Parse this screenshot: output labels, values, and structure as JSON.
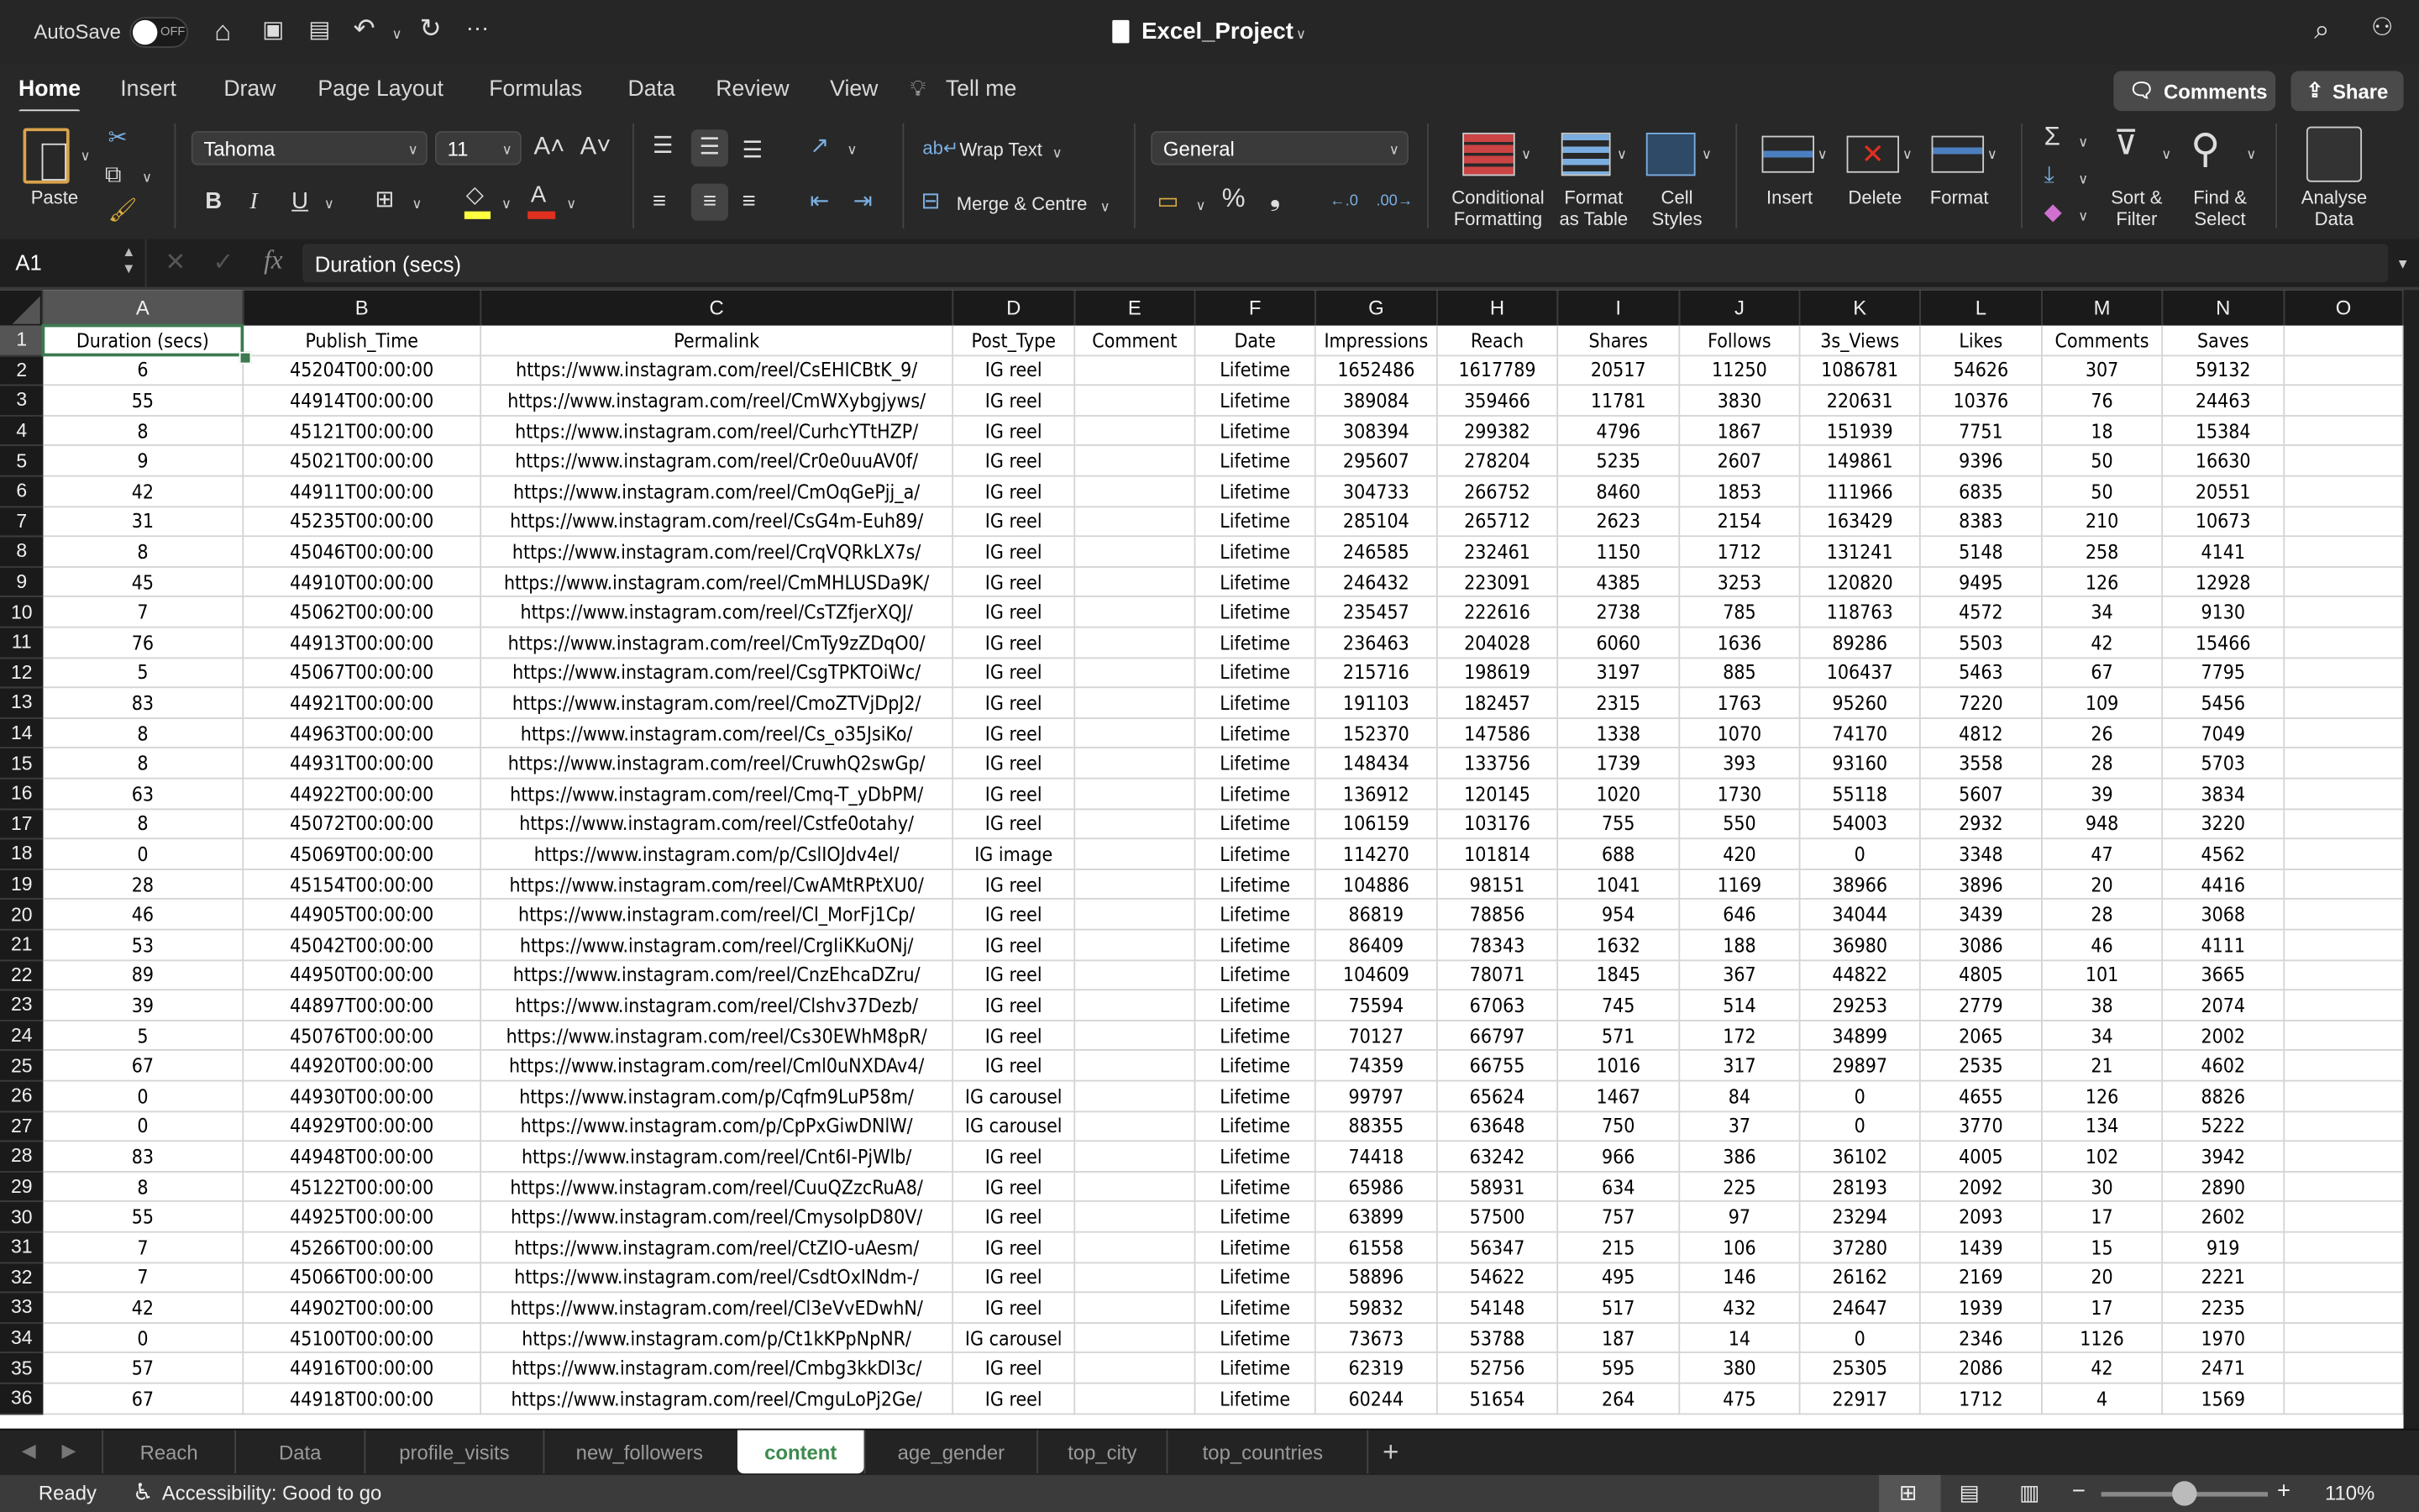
{
  "titlebar": {
    "autosave_label": "AutoSave",
    "autosave_state": "OFF",
    "title": "Excel_Project"
  },
  "menu_tabs": [
    "Home",
    "Insert",
    "Draw",
    "Page Layout",
    "Formulas",
    "Data",
    "Review",
    "View"
  ],
  "tell_me": "Tell me",
  "comments_label": "Comments",
  "share_label": "Share",
  "ribbon": {
    "paste": "Paste",
    "font_name": "Tahoma",
    "font_size": "11",
    "bold": "B",
    "italic": "I",
    "underline": "U",
    "wrap_text": "Wrap Text",
    "merge_centre": "Merge & Centre",
    "number_format": "General",
    "conditional_formatting": [
      "Conditional",
      "Formatting"
    ],
    "format_as_table": [
      "Format",
      "as Table"
    ],
    "cell_styles": [
      "Cell",
      "Styles"
    ],
    "insert": "Insert",
    "delete": "Delete",
    "format": "Format",
    "sort_filter": [
      "Sort &",
      "Filter"
    ],
    "find_select": [
      "Find &",
      "Select"
    ],
    "analyse_data": [
      "Analyse",
      "Data"
    ],
    "fill_color": "#ffff00",
    "font_color": "#e03020"
  },
  "formula_bar": {
    "name_box": "A1",
    "fx": "fx",
    "content": "Duration (secs)"
  },
  "columns": [
    "A",
    "B",
    "C",
    "D",
    "E",
    "F",
    "G",
    "H",
    "I",
    "J",
    "K",
    "L",
    "M",
    "N",
    "O"
  ],
  "header_row": [
    "Duration (secs)",
    "Publish_Time",
    "Permalink",
    "Post_Type",
    "Comment",
    "Date",
    "Impressions",
    "Reach",
    "Shares",
    "Follows",
    "3s_Views",
    "Likes",
    "Comments",
    "Saves",
    ""
  ],
  "rows": [
    [
      "6",
      "45204T00:00:00",
      "https://www.instagram.com/reel/CsEHICBtK_9/",
      "IG reel",
      "",
      "Lifetime",
      "1652486",
      "1617789",
      "20517",
      "11250",
      "1086781",
      "54626",
      "307",
      "59132",
      ""
    ],
    [
      "55",
      "44914T00:00:00",
      "https://www.instagram.com/reel/CmWXybgjyws/",
      "IG reel",
      "",
      "Lifetime",
      "389084",
      "359466",
      "11781",
      "3830",
      "220631",
      "10376",
      "76",
      "24463",
      ""
    ],
    [
      "8",
      "45121T00:00:00",
      "https://www.instagram.com/reel/CurhcYTtHZP/",
      "IG reel",
      "",
      "Lifetime",
      "308394",
      "299382",
      "4796",
      "1867",
      "151939",
      "7751",
      "18",
      "15384",
      ""
    ],
    [
      "9",
      "45021T00:00:00",
      "https://www.instagram.com/reel/Cr0e0uuAV0f/",
      "IG reel",
      "",
      "Lifetime",
      "295607",
      "278204",
      "5235",
      "2607",
      "149861",
      "9396",
      "50",
      "16630",
      ""
    ],
    [
      "42",
      "44911T00:00:00",
      "https://www.instagram.com/reel/CmOqGePjj_a/",
      "IG reel",
      "",
      "Lifetime",
      "304733",
      "266752",
      "8460",
      "1853",
      "111966",
      "6835",
      "50",
      "20551",
      ""
    ],
    [
      "31",
      "45235T00:00:00",
      "https://www.instagram.com/reel/CsG4m-Euh89/",
      "IG reel",
      "",
      "Lifetime",
      "285104",
      "265712",
      "2623",
      "2154",
      "163429",
      "8383",
      "210",
      "10673",
      ""
    ],
    [
      "8",
      "45046T00:00:00",
      "https://www.instagram.com/reel/CrqVQRkLX7s/",
      "IG reel",
      "",
      "Lifetime",
      "246585",
      "232461",
      "1150",
      "1712",
      "131241",
      "5148",
      "258",
      "4141",
      ""
    ],
    [
      "45",
      "44910T00:00:00",
      "https://www.instagram.com/reel/CmMHLUSDa9K/",
      "IG reel",
      "",
      "Lifetime",
      "246432",
      "223091",
      "4385",
      "3253",
      "120820",
      "9495",
      "126",
      "12928",
      ""
    ],
    [
      "7",
      "45062T00:00:00",
      "https://www.instagram.com/reel/CsTZfjerXQJ/",
      "IG reel",
      "",
      "Lifetime",
      "235457",
      "222616",
      "2738",
      "785",
      "118763",
      "4572",
      "34",
      "9130",
      ""
    ],
    [
      "76",
      "44913T00:00:00",
      "https://www.instagram.com/reel/CmTy9zZDqO0/",
      "IG reel",
      "",
      "Lifetime",
      "236463",
      "204028",
      "6060",
      "1636",
      "89286",
      "5503",
      "42",
      "15466",
      ""
    ],
    [
      "5",
      "45067T00:00:00",
      "https://www.instagram.com/reel/CsgTPKTOiWc/",
      "IG reel",
      "",
      "Lifetime",
      "215716",
      "198619",
      "3197",
      "885",
      "106437",
      "5463",
      "67",
      "7795",
      ""
    ],
    [
      "83",
      "44921T00:00:00",
      "https://www.instagram.com/reel/CmoZTVjDpJ2/",
      "IG reel",
      "",
      "Lifetime",
      "191103",
      "182457",
      "2315",
      "1763",
      "95260",
      "7220",
      "109",
      "5456",
      ""
    ],
    [
      "8",
      "44963T00:00:00",
      "https://www.instagram.com/reel/Cs_o35JsiKo/",
      "IG reel",
      "",
      "Lifetime",
      "152370",
      "147586",
      "1338",
      "1070",
      "74170",
      "4812",
      "26",
      "7049",
      ""
    ],
    [
      "8",
      "44931T00:00:00",
      "https://www.instagram.com/reel/CruwhQ2swGp/",
      "IG reel",
      "",
      "Lifetime",
      "148434",
      "133756",
      "1739",
      "393",
      "93160",
      "3558",
      "28",
      "5703",
      ""
    ],
    [
      "63",
      "44922T00:00:00",
      "https://www.instagram.com/reel/Cmq-T_yDbPM/",
      "IG reel",
      "",
      "Lifetime",
      "136912",
      "120145",
      "1020",
      "1730",
      "55118",
      "5607",
      "39",
      "3834",
      ""
    ],
    [
      "8",
      "45072T00:00:00",
      "https://www.instagram.com/reel/Cstfe0otahy/",
      "IG reel",
      "",
      "Lifetime",
      "106159",
      "103176",
      "755",
      "550",
      "54003",
      "2932",
      "948",
      "3220",
      ""
    ],
    [
      "0",
      "45069T00:00:00",
      "https://www.instagram.com/p/CslIOJdv4el/",
      "IG image",
      "",
      "Lifetime",
      "114270",
      "101814",
      "688",
      "420",
      "0",
      "3348",
      "47",
      "4562",
      ""
    ],
    [
      "28",
      "45154T00:00:00",
      "https://www.instagram.com/reel/CwAMtRPtXU0/",
      "IG reel",
      "",
      "Lifetime",
      "104886",
      "98151",
      "1041",
      "1169",
      "38966",
      "3896",
      "20",
      "4416",
      ""
    ],
    [
      "46",
      "44905T00:00:00",
      "https://www.instagram.com/reel/Cl_MorFj1Cp/",
      "IG reel",
      "",
      "Lifetime",
      "86819",
      "78856",
      "954",
      "646",
      "34044",
      "3439",
      "28",
      "3068",
      ""
    ],
    [
      "53",
      "45042T00:00:00",
      "https://www.instagram.com/reel/CrgIiKKuONj/",
      "IG reel",
      "",
      "Lifetime",
      "86409",
      "78343",
      "1632",
      "188",
      "36980",
      "3086",
      "46",
      "4111",
      ""
    ],
    [
      "89",
      "44950T00:00:00",
      "https://www.instagram.com/reel/CnzEhcaDZru/",
      "IG reel",
      "",
      "Lifetime",
      "104609",
      "78071",
      "1845",
      "367",
      "44822",
      "4805",
      "101",
      "3665",
      ""
    ],
    [
      "39",
      "44897T00:00:00",
      "https://www.instagram.com/reel/Clshv37Dezb/",
      "IG reel",
      "",
      "Lifetime",
      "75594",
      "67063",
      "745",
      "514",
      "29253",
      "2779",
      "38",
      "2074",
      ""
    ],
    [
      "5",
      "45076T00:00:00",
      "https://www.instagram.com/reel/Cs30EWhM8pR/",
      "IG reel",
      "",
      "Lifetime",
      "70127",
      "66797",
      "571",
      "172",
      "34899",
      "2065",
      "34",
      "2002",
      ""
    ],
    [
      "67",
      "44920T00:00:00",
      "https://www.instagram.com/reel/Cml0uNXDAv4/",
      "IG reel",
      "",
      "Lifetime",
      "74359",
      "66755",
      "1016",
      "317",
      "29897",
      "2535",
      "21",
      "4602",
      ""
    ],
    [
      "0",
      "44930T00:00:00",
      "https://www.instagram.com/p/Cqfm9LuP58m/",
      "IG carousel",
      "",
      "Lifetime",
      "99797",
      "65624",
      "1467",
      "84",
      "0",
      "4655",
      "126",
      "8826",
      ""
    ],
    [
      "0",
      "44929T00:00:00",
      "https://www.instagram.com/p/CpPxGiwDNlW/",
      "IG carousel",
      "",
      "Lifetime",
      "88355",
      "63648",
      "750",
      "37",
      "0",
      "3770",
      "134",
      "5222",
      ""
    ],
    [
      "83",
      "44948T00:00:00",
      "https://www.instagram.com/reel/Cnt6I-PjWlb/",
      "IG reel",
      "",
      "Lifetime",
      "74418",
      "63242",
      "966",
      "386",
      "36102",
      "4005",
      "102",
      "3942",
      ""
    ],
    [
      "8",
      "45122T00:00:00",
      "https://www.instagram.com/reel/CuuQZzcRuA8/",
      "IG reel",
      "",
      "Lifetime",
      "65986",
      "58931",
      "634",
      "225",
      "28193",
      "2092",
      "30",
      "2890",
      ""
    ],
    [
      "55",
      "44925T00:00:00",
      "https://www.instagram.com/reel/CmysoIpD80V/",
      "IG reel",
      "",
      "Lifetime",
      "63899",
      "57500",
      "757",
      "97",
      "23294",
      "2093",
      "17",
      "2602",
      ""
    ],
    [
      "7",
      "45266T00:00:00",
      "https://www.instagram.com/reel/CtZIO-uAesm/",
      "IG reel",
      "",
      "Lifetime",
      "61558",
      "56347",
      "215",
      "106",
      "37280",
      "1439",
      "15",
      "919",
      ""
    ],
    [
      "7",
      "45066T00:00:00",
      "https://www.instagram.com/reel/CsdtOxINdm-/",
      "IG reel",
      "",
      "Lifetime",
      "58896",
      "54622",
      "495",
      "146",
      "26162",
      "2169",
      "20",
      "2221",
      ""
    ],
    [
      "42",
      "44902T00:00:00",
      "https://www.instagram.com/reel/Cl3eVvEDwhN/",
      "IG reel",
      "",
      "Lifetime",
      "59832",
      "54148",
      "517",
      "432",
      "24647",
      "1939",
      "17",
      "2235",
      ""
    ],
    [
      "0",
      "45100T00:00:00",
      "https://www.instagram.com/p/Ct1kKPpNpNR/",
      "IG carousel",
      "",
      "Lifetime",
      "73673",
      "53788",
      "187",
      "14",
      "0",
      "2346",
      "1126",
      "1970",
      ""
    ],
    [
      "57",
      "44916T00:00:00",
      "https://www.instagram.com/reel/Cmbg3kkDl3c/",
      "IG reel",
      "",
      "Lifetime",
      "62319",
      "52756",
      "595",
      "380",
      "25305",
      "2086",
      "42",
      "2471",
      ""
    ],
    [
      "67",
      "44918T00:00:00",
      "https://www.instagram.com/reel/CmguLoPj2Ge/",
      "IG reel",
      "",
      "Lifetime",
      "60244",
      "51654",
      "264",
      "475",
      "22917",
      "1712",
      "4",
      "1569",
      ""
    ]
  ],
  "sheet_tabs": [
    "Reach",
    "Data",
    "profile_visits",
    "new_followers",
    "content",
    "age_gender",
    "top_city",
    "top_countries"
  ],
  "active_sheet": "content",
  "add_sheet": "+",
  "status": {
    "ready": "Ready",
    "accessibility": "Accessibility: Good to go",
    "zoom": "110%",
    "zoom_level_percent": 110
  },
  "accent_color": "#3c8a4f"
}
